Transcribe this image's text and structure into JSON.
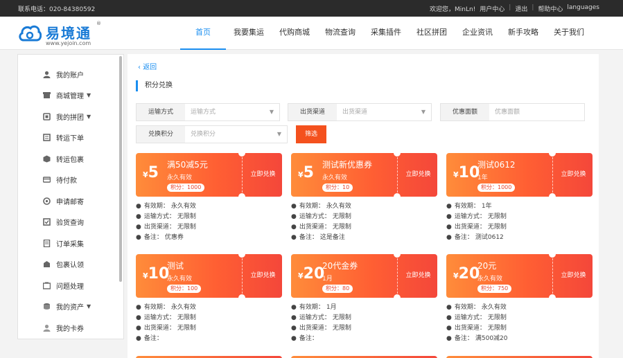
{
  "topbar": {
    "hotline": "联系电话：020-84380592",
    "welcome": "欢迎您，MinLn!",
    "user_center": "用户中心",
    "logout": "退出",
    "help_center": "帮助中心",
    "languages": "languages"
  },
  "logo": {
    "name": "易境通",
    "reg": "®",
    "url": "www.yejoin.com"
  },
  "nav": [
    {
      "label": "首页",
      "active": true
    },
    {
      "label": "我要集运"
    },
    {
      "label": "代购商城"
    },
    {
      "label": "物流查询"
    },
    {
      "label": "采集插件"
    },
    {
      "label": "社区拼团"
    },
    {
      "label": "企业资讯"
    },
    {
      "label": "新手攻略"
    },
    {
      "label": "关于我们"
    }
  ],
  "sidebar": [
    {
      "label": "我的账户",
      "icon": "user-icon"
    },
    {
      "label": "商城管理",
      "icon": "shop-icon",
      "caret": true
    },
    {
      "label": "我的拼团",
      "icon": "group-icon",
      "caret": true
    },
    {
      "label": "转运下单",
      "icon": "transfer-icon"
    },
    {
      "label": "转运包裹",
      "icon": "package-icon"
    },
    {
      "label": "待付款",
      "icon": "payment-icon"
    },
    {
      "label": "申请邮寄",
      "icon": "mail-icon"
    },
    {
      "label": "验货查询",
      "icon": "inspect-icon"
    },
    {
      "label": "订单采集",
      "icon": "order-icon"
    },
    {
      "label": "包裹认领",
      "icon": "claim-icon"
    },
    {
      "label": "问题处理",
      "icon": "problem-icon"
    },
    {
      "label": "我的资产",
      "icon": "assets-icon",
      "caret": true
    },
    {
      "label": "我的卡券",
      "icon": "coupon-icon"
    }
  ],
  "main": {
    "back": "返回",
    "title": "积分兑换",
    "filters": {
      "transport_label": "运输方式",
      "transport_placeholder": "运输方式",
      "channel_label": "出货渠道",
      "channel_placeholder": "出货渠道",
      "face_label": "优惠面额",
      "face_placeholder": "优惠面额",
      "points_label": "兑换积分",
      "points_placeholder": "兑换积分",
      "submit": "筛选"
    },
    "coupons": [
      {
        "cur": "¥",
        "amount": "5",
        "name": "满50减5元",
        "validity": "永久有效",
        "points": "积分：1000",
        "redeem": "立即兑换",
        "details": [
          [
            "有效期：",
            "永久有效"
          ],
          [
            "运输方式：",
            "无限制"
          ],
          [
            "出货渠道：",
            "无限制"
          ],
          [
            "备注：",
            "优惠券"
          ]
        ]
      },
      {
        "cur": "¥",
        "amount": "5",
        "name": "测试新优惠券",
        "validity": "永久有效",
        "points": "积分：10",
        "redeem": "立即兑换",
        "details": [
          [
            "有效期：",
            "永久有效"
          ],
          [
            "运输方式：",
            "无限制"
          ],
          [
            "出货渠道：",
            "无限制"
          ],
          [
            "备注：",
            "这是备注"
          ]
        ]
      },
      {
        "cur": "¥",
        "amount": "10",
        "name": "测试0612",
        "validity": "1年",
        "points": "积分：1000",
        "redeem": "立即兑换",
        "details": [
          [
            "有效期：",
            "1年"
          ],
          [
            "运输方式：",
            "无限制"
          ],
          [
            "出货渠道：",
            "无限制"
          ],
          [
            "备注：",
            "测试0612"
          ]
        ]
      },
      {
        "cur": "¥",
        "amount": "10",
        "name": "测试",
        "validity": "永久有效",
        "points": "积分：100",
        "redeem": "立即兑换",
        "details": [
          [
            "有效期：",
            "永久有效"
          ],
          [
            "运输方式：",
            "无限制"
          ],
          [
            "出货渠道：",
            "无限制"
          ],
          [
            "备注：",
            ""
          ]
        ]
      },
      {
        "cur": "¥",
        "amount": "20",
        "name": "20代金券",
        "validity": "1月",
        "points": "积分：80",
        "redeem": "立即兑换",
        "details": [
          [
            "有效期：",
            "1月"
          ],
          [
            "运输方式：",
            "无限制"
          ],
          [
            "出货渠道：",
            "无限制"
          ],
          [
            "备注：",
            ""
          ]
        ]
      },
      {
        "cur": "¥",
        "amount": "20",
        "name": "20元",
        "validity": "永久有效",
        "points": "积分：750",
        "redeem": "立即兑换",
        "details": [
          [
            "有效期：",
            "永久有效"
          ],
          [
            "运输方式：",
            "无限制"
          ],
          [
            "出货渠道：",
            "无限制"
          ],
          [
            "备注：",
            "满500减20"
          ]
        ]
      }
    ]
  }
}
